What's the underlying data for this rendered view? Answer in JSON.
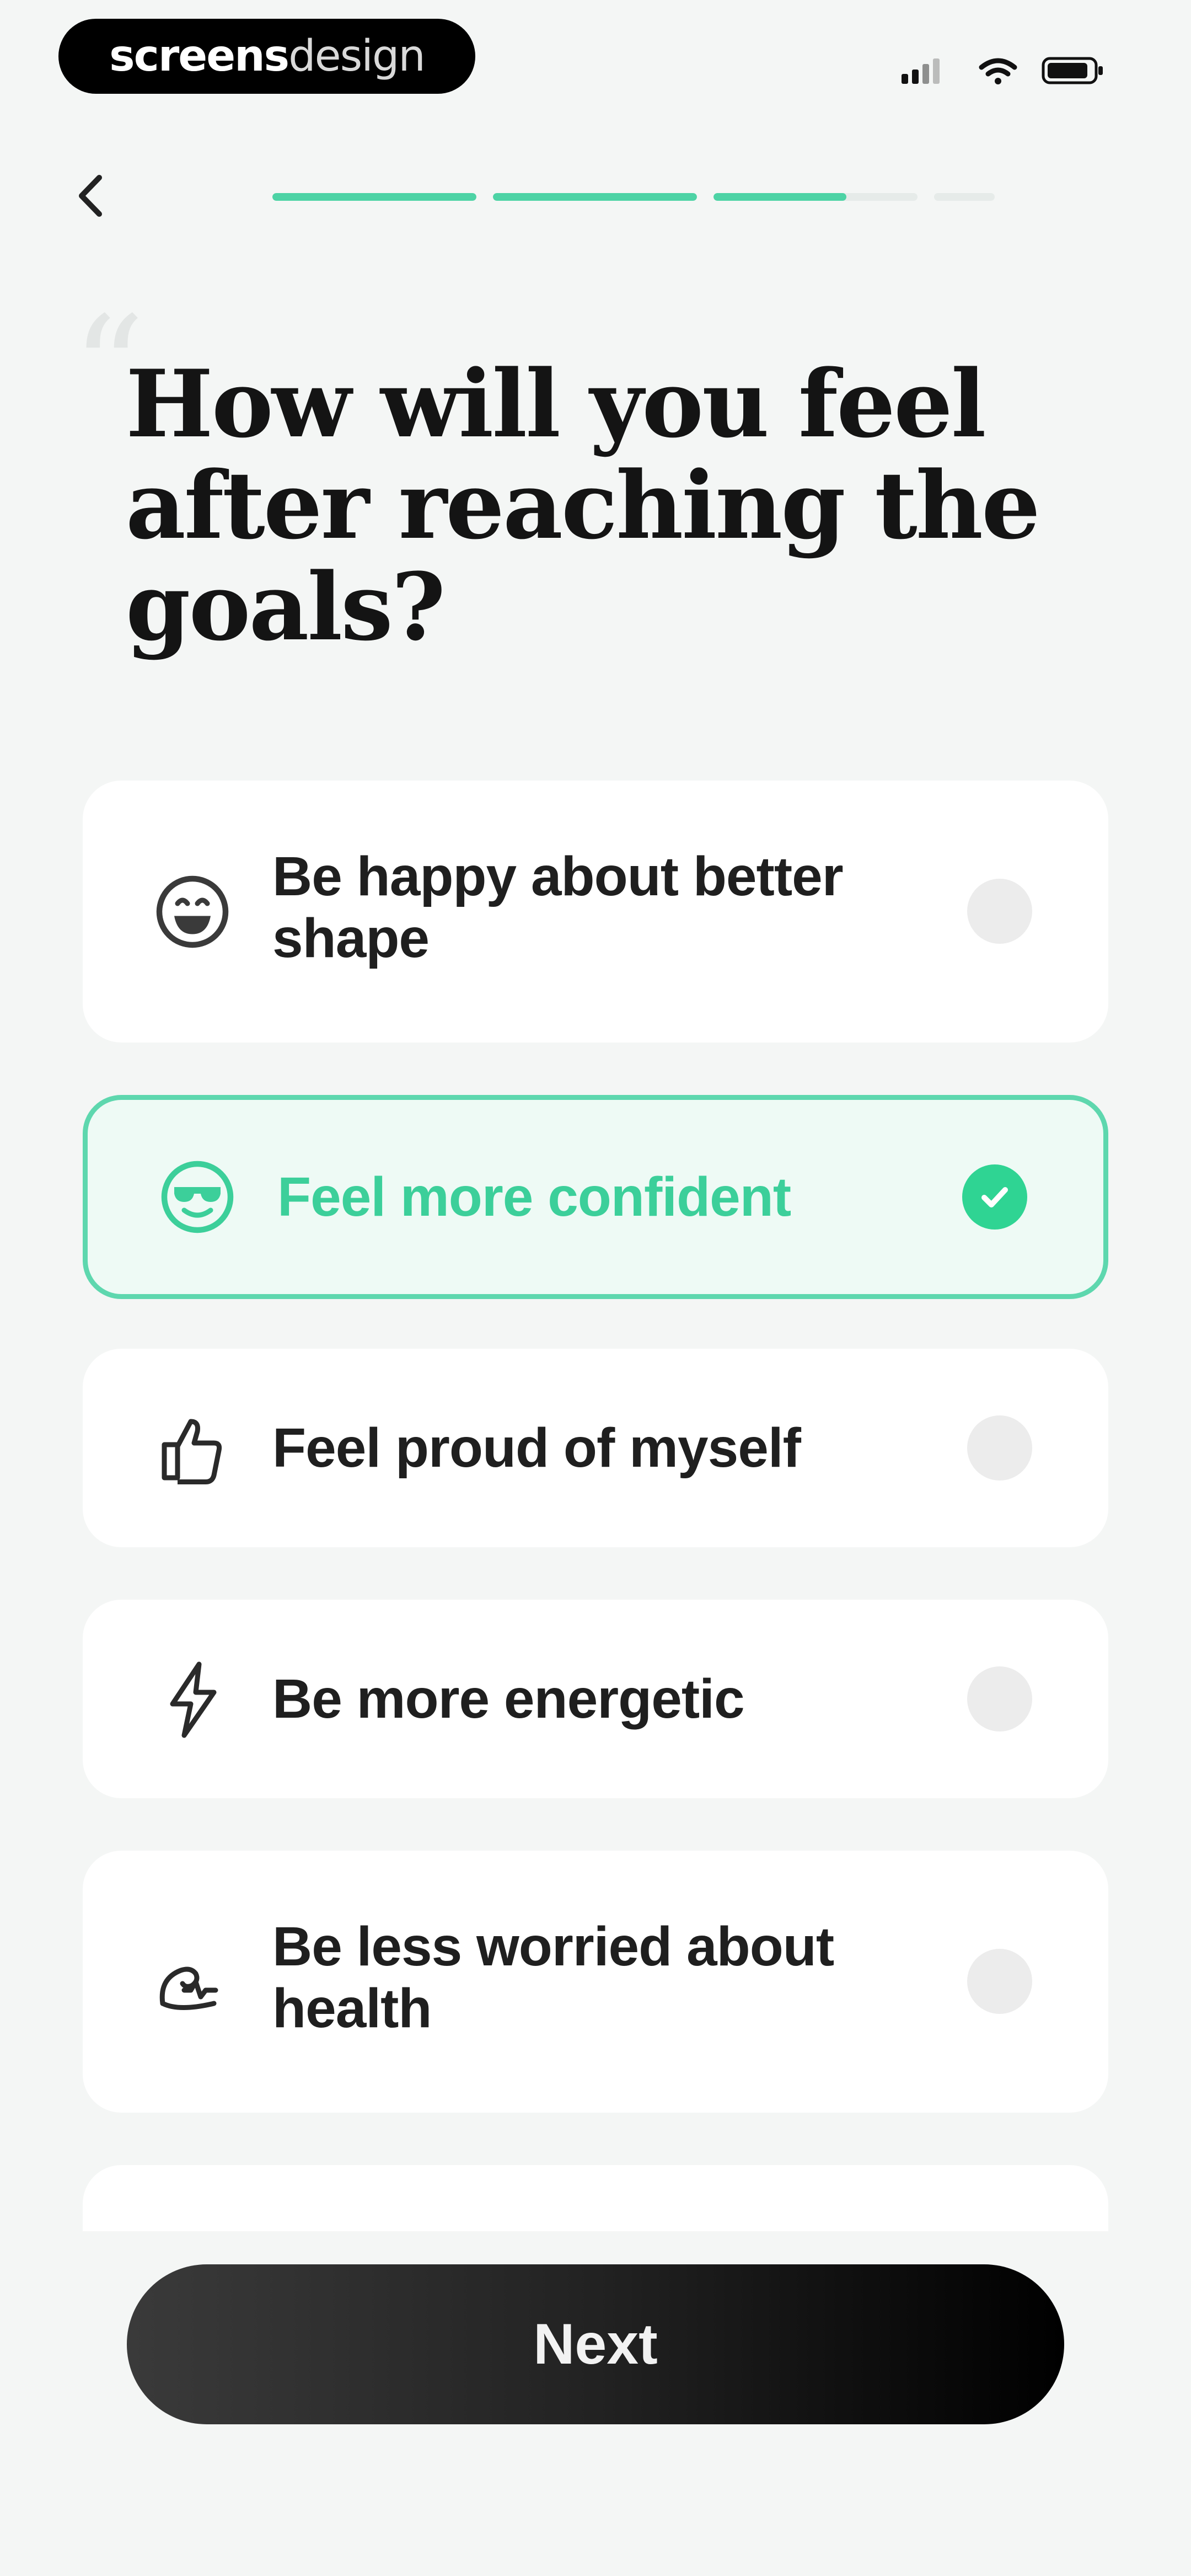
{
  "status_bar": {
    "brand_bold": "screens",
    "brand_light": "design"
  },
  "header": {
    "progress": {
      "segments": 4,
      "filled": [
        1,
        1,
        0.65,
        0
      ]
    }
  },
  "title": "How will you feel after reaching the goals?",
  "options": [
    {
      "label": "Be happy about better shape",
      "icon": "grinning-face-icon",
      "selected": false
    },
    {
      "label": "Feel more confident",
      "icon": "cool-face-icon",
      "selected": true
    },
    {
      "label": "Feel proud of myself",
      "icon": "thumbs-up-icon",
      "selected": false
    },
    {
      "label": "Be more energetic",
      "icon": "lightning-bolt-icon",
      "selected": false
    },
    {
      "label": "Be less worried about health",
      "icon": "health-pulse-icon",
      "selected": false
    }
  ],
  "next_button": {
    "label": "Next"
  },
  "colors": {
    "accent": "#3ccf9a",
    "selected_border": "#5ed7ae",
    "selected_bg": "#eefaf5",
    "background": "#f4f6f5"
  }
}
